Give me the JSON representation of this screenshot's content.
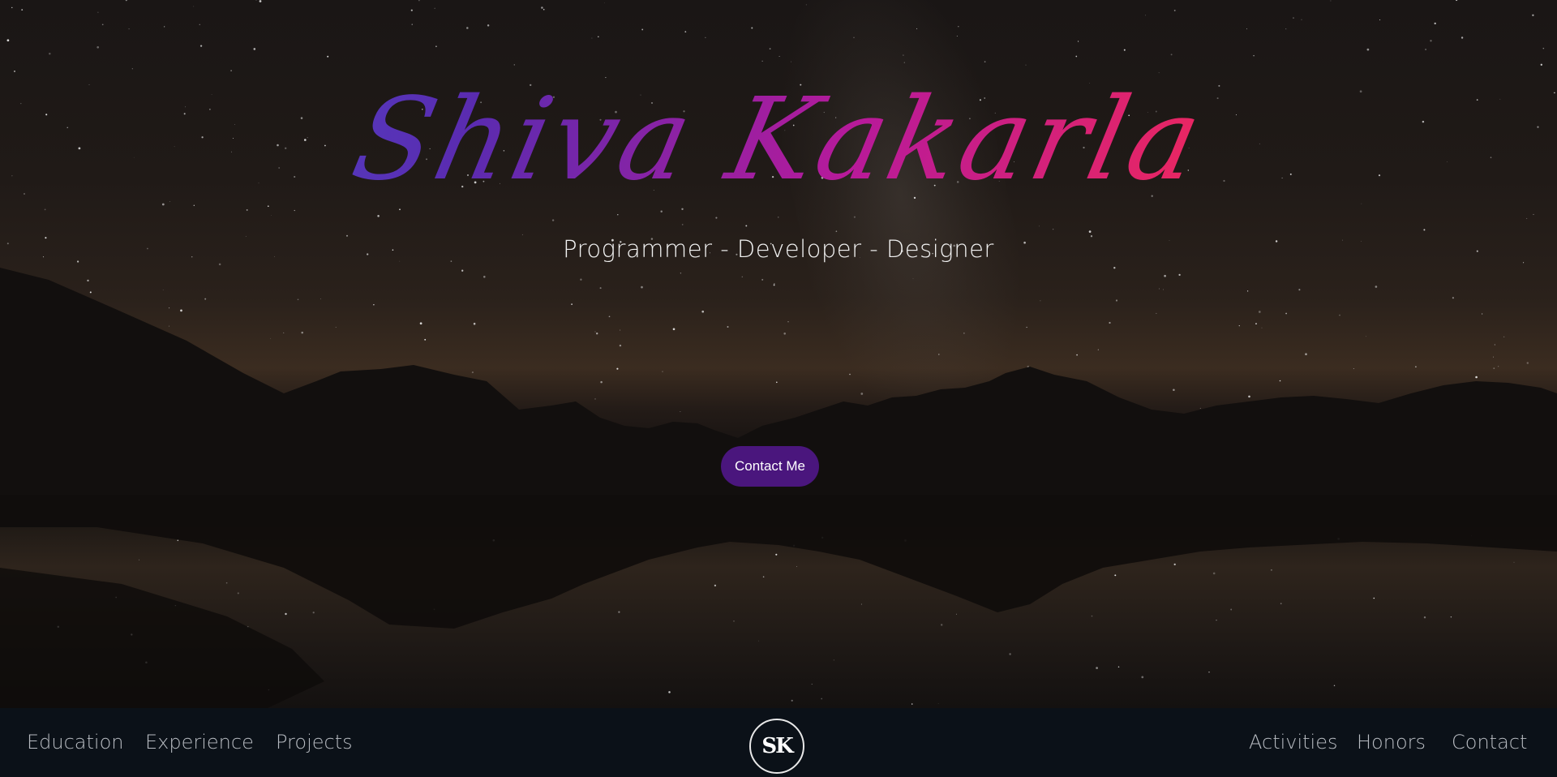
{
  "hero": {
    "name": "Shiva Kakarla",
    "tagline": "Programmer - Developer - Designer",
    "contact_button": "Contact Me",
    "accent_color": "#4a167d",
    "gradient_colors": [
      "#4a56d8",
      "#5a2bb0",
      "#b81a9a",
      "#f0285a",
      "#ff5a3a"
    ]
  },
  "nav": {
    "left": [
      "Education",
      "Experience",
      "Projects"
    ],
    "logo": "SK",
    "right": [
      "Activities",
      "Honors",
      "Contact"
    ]
  }
}
